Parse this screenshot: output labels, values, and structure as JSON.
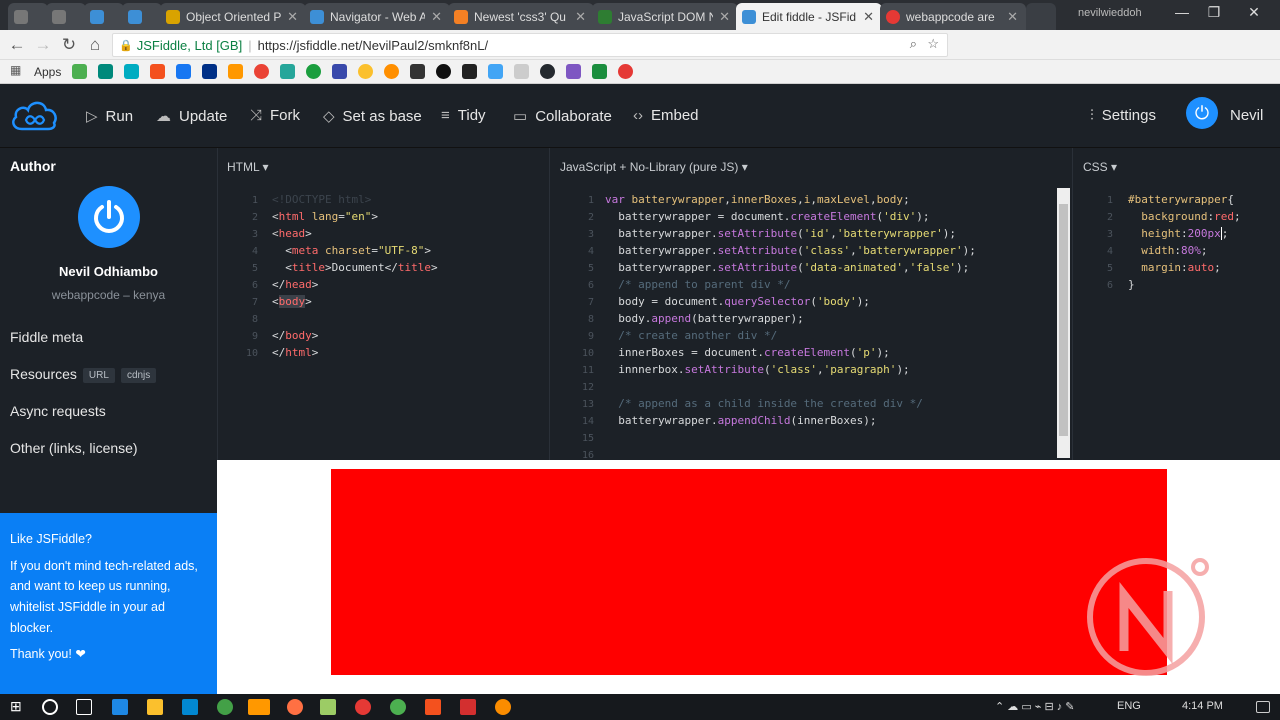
{
  "browser": {
    "tabs": [
      {
        "label": "",
        "color": "#777"
      },
      {
        "label": "",
        "color": "#777"
      },
      {
        "label": "",
        "color": "#3d8fd6"
      },
      {
        "label": "",
        "color": "#3d8fd6"
      },
      {
        "label": "Object Oriented P",
        "color": "#d9a300"
      },
      {
        "label": "Navigator - Web A",
        "color": "#3d8fd6"
      },
      {
        "label": "Newest 'css3' Qu",
        "color": "#f48024"
      },
      {
        "label": "JavaScript DOM N",
        "color": "#2e7d32"
      },
      {
        "label": "Edit fiddle - JSFid",
        "color": "#3d8fd6"
      },
      {
        "label": "webappcode are",
        "color": "#e53935"
      }
    ],
    "user": "nevilwieddoh",
    "address": {
      "org": "JSFiddle, Ltd [GB]",
      "url": "https://jsfiddle.net/NevilPaul2/smknf8nL/"
    },
    "bookmarks_apps": "Apps"
  },
  "header": {
    "run": "Run",
    "update": "Update",
    "fork": "Fork",
    "set_as_base": "Set as base",
    "tidy": "Tidy",
    "collaborate": "Collaborate",
    "embed": "Embed",
    "settings": "Settings",
    "user": "Nevil"
  },
  "sidebar": {
    "author_heading": "Author",
    "author_name": "Nevil Odhiambo",
    "author_sub": "webappcode – kenya",
    "fiddle_meta": "Fiddle meta",
    "resources": "Resources",
    "tag_url": "URL",
    "tag_cdnjs": "cdnjs",
    "async": "Async requests",
    "other": "Other (links, license)",
    "promo_title": "Like JSFiddle?",
    "promo_body": "If you don't mind tech-related ads, and want to keep us running, whitelist JSFiddle in your ad blocker.",
    "promo_thanks": "Thank you! ❤"
  },
  "panels": {
    "html_label": "HTML ▾",
    "js_label": "JavaScript + No-Library (pure JS) ▾",
    "css_label": "CSS ▾"
  },
  "taskbar": {
    "lang": "ENG",
    "time": "4:14 PM"
  },
  "colors": {
    "result_box": "#ff0000",
    "promo": "#0a7ff5",
    "header": "#1c2127"
  }
}
